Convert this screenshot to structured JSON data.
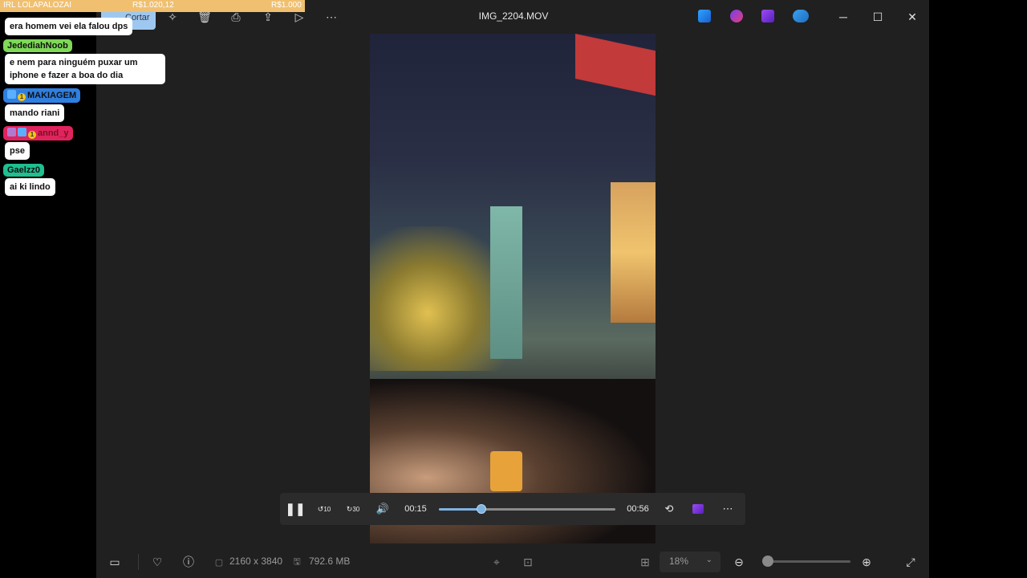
{
  "window": {
    "file_title": "IMG_2204.MOV"
  },
  "toolbar": {
    "icons": [
      "crop-icon",
      "magic-icon",
      "delete-icon",
      "print-icon",
      "share-icon",
      "slideshow-icon",
      "more-icon"
    ],
    "apps": [
      "clipchamp-icon",
      "designer-icon",
      "video-editor-icon",
      "onedrive-icon"
    ]
  },
  "player": {
    "current_time": "00:15",
    "duration": "00:56",
    "progress": 0.24,
    "rewind_label": "10",
    "forward_label": "30"
  },
  "bottom_bar": {
    "dimensions": "2160 x 3840",
    "file_size": "792.6 MB",
    "zoom": "18%",
    "zoom_level": 0.05
  },
  "overlay": {
    "stream_title": "IRL LOLAPALOZAI",
    "donation_1": "R$1.020,12",
    "donation_2": "R$1.000",
    "crop_label": "Cortar",
    "chat": [
      {
        "user": "",
        "message": "era homem vei ela falou dps",
        "color": "#e0e0e0"
      },
      {
        "user": "JedediahNoob",
        "message": "e nem para ninguém puxar um iphone e fazer a boa do dia",
        "color": "#7ed957"
      },
      {
        "user": "MAKIAGEM",
        "message": "mando riani",
        "color": "#2f7fe0"
      },
      {
        "user": "annd_y",
        "message": "pse",
        "color": "#e0245e"
      },
      {
        "user": "Gaelzz0",
        "message": "ai ki lindo",
        "color": "#1fbf8f"
      }
    ]
  }
}
